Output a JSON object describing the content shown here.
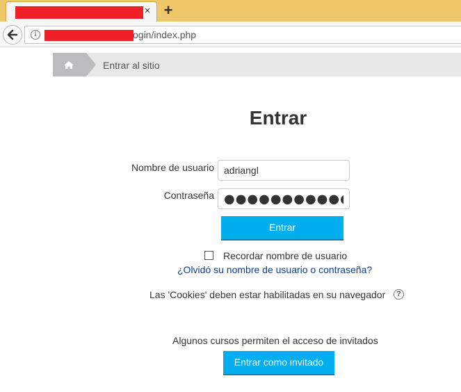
{
  "browser": {
    "tab_close_glyph": "×",
    "new_tab_glyph": "+",
    "url_visible": "ogin/index.php",
    "info_glyph": "i"
  },
  "breadcrumb": {
    "home_icon": "home-icon",
    "current": "Entrar al sitio"
  },
  "login": {
    "title": "Entrar",
    "username_label": "Nombre de usuario",
    "username_value": "adriangl",
    "password_label": "Contraseña",
    "password_value": "●●●●●●●●●●●●●●●",
    "login_button": "Entrar",
    "remember_label": "Recordar nombre de usuario",
    "remember_checked": false,
    "forgot_link": "¿Olvidó su nombre de usuario o contraseña?",
    "cookies_notice": "Las 'Cookies' deben estar habilitadas en su navegador",
    "help_glyph": "?",
    "guest_notice": "Algunos cursos permiten el acceso de invitados",
    "guest_button": "Entrar como invitado"
  },
  "colors": {
    "accent": "#00aeef",
    "link": "#0b3d91",
    "tabbar": "#f0c869",
    "redaction": "#ef1f26"
  }
}
